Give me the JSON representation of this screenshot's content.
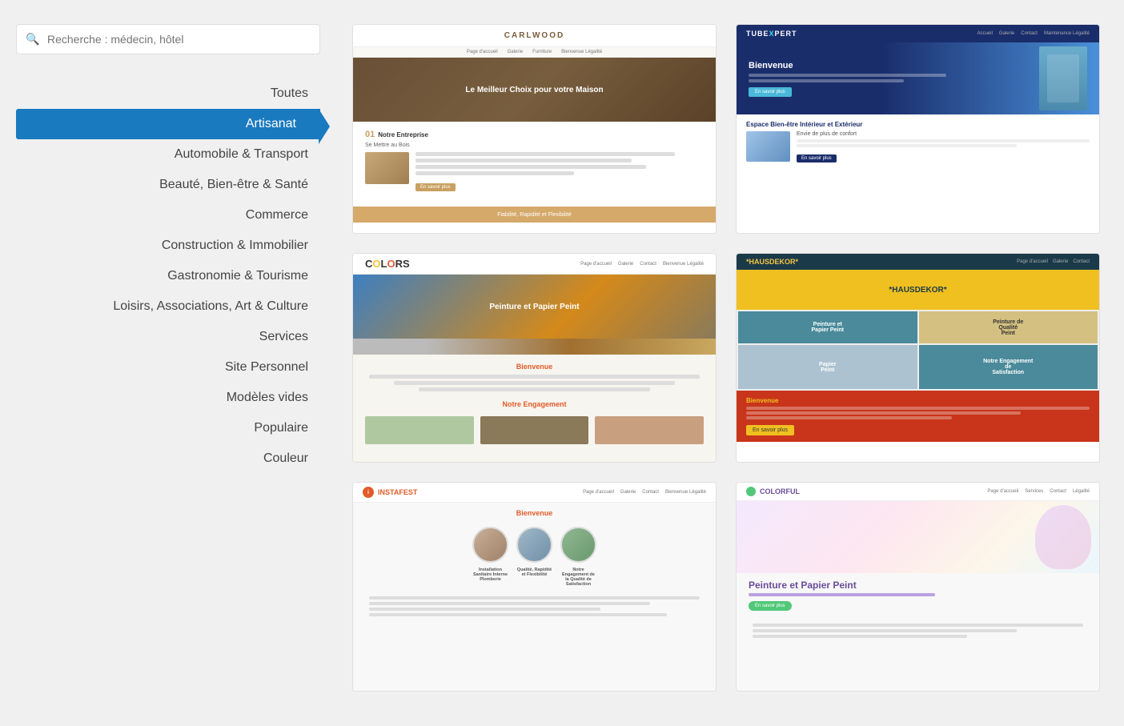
{
  "search": {
    "placeholder": "Recherche : médecin, hôtel"
  },
  "sidebar": {
    "items": [
      {
        "id": "toutes",
        "label": "Toutes",
        "active": false
      },
      {
        "id": "artisanat",
        "label": "Artisanat",
        "active": true
      },
      {
        "id": "automobile",
        "label": "Automobile & Transport",
        "active": false
      },
      {
        "id": "beaute",
        "label": "Beauté, Bien-être & Santé",
        "active": false
      },
      {
        "id": "commerce",
        "label": "Commerce",
        "active": false
      },
      {
        "id": "construction",
        "label": "Construction & Immobilier",
        "active": false
      },
      {
        "id": "gastronomie",
        "label": "Gastronomie & Tourisme",
        "active": false
      },
      {
        "id": "loisirs",
        "label": "Loisirs, Associations, Art & Culture",
        "active": false
      },
      {
        "id": "services",
        "label": "Services",
        "active": false
      },
      {
        "id": "site-personnel",
        "label": "Site Personnel",
        "active": false
      },
      {
        "id": "modeles-vides",
        "label": "Modèles vides",
        "active": false
      },
      {
        "id": "populaire",
        "label": "Populaire",
        "active": false
      },
      {
        "id": "couleur",
        "label": "Couleur",
        "active": false
      }
    ]
  },
  "templates": [
    {
      "id": "carlwood",
      "name": "Carlwood",
      "category": "artisanat",
      "hero_text": "Le Meilleur Choix pour votre Maison",
      "section_title": "Notre Entreprise",
      "sub_title": "Se Mettre au Bois",
      "footer_text": "Fiabilité, Rapidité et Flexibilité"
    },
    {
      "id": "tubexpert",
      "name": "TubeXpert",
      "category": "artisanat",
      "welcome_text": "Bienvenue",
      "section_title": "Espace Bien-être Intérieur et Extérieur",
      "sub_text": "Envie de plus de confort"
    },
    {
      "id": "colors",
      "name": "Colors",
      "category": "artisanat",
      "hero_text": "Peinture et Papier Peint",
      "bienvenue": "Bienvenue",
      "engagement": "Notre Engagement"
    },
    {
      "id": "hausdekor",
      "name": "*HAUSDEKOR*",
      "category": "artisanat",
      "cells": [
        "Peinture et Papier Peint",
        "Peinture de Qualité",
        "Papier Peint",
        "Notre Engagement de Satisfaction"
      ],
      "welcome_title": "Bienvenue",
      "cta": "En savoir plus"
    },
    {
      "id": "instafest",
      "name": "Instafest",
      "category": "artisanat",
      "bienvenue": "Bienvenue",
      "circle_labels": [
        "Installation Sanitaire Interne Plomberie",
        "Qualité, Rapidité et Flexibilité",
        "Notre Engagement de la Qualité de Satisfaction"
      ]
    },
    {
      "id": "colorful",
      "name": "Colorful",
      "category": "artisanat",
      "hero_title": "Peinture et Papier Peint"
    }
  ]
}
